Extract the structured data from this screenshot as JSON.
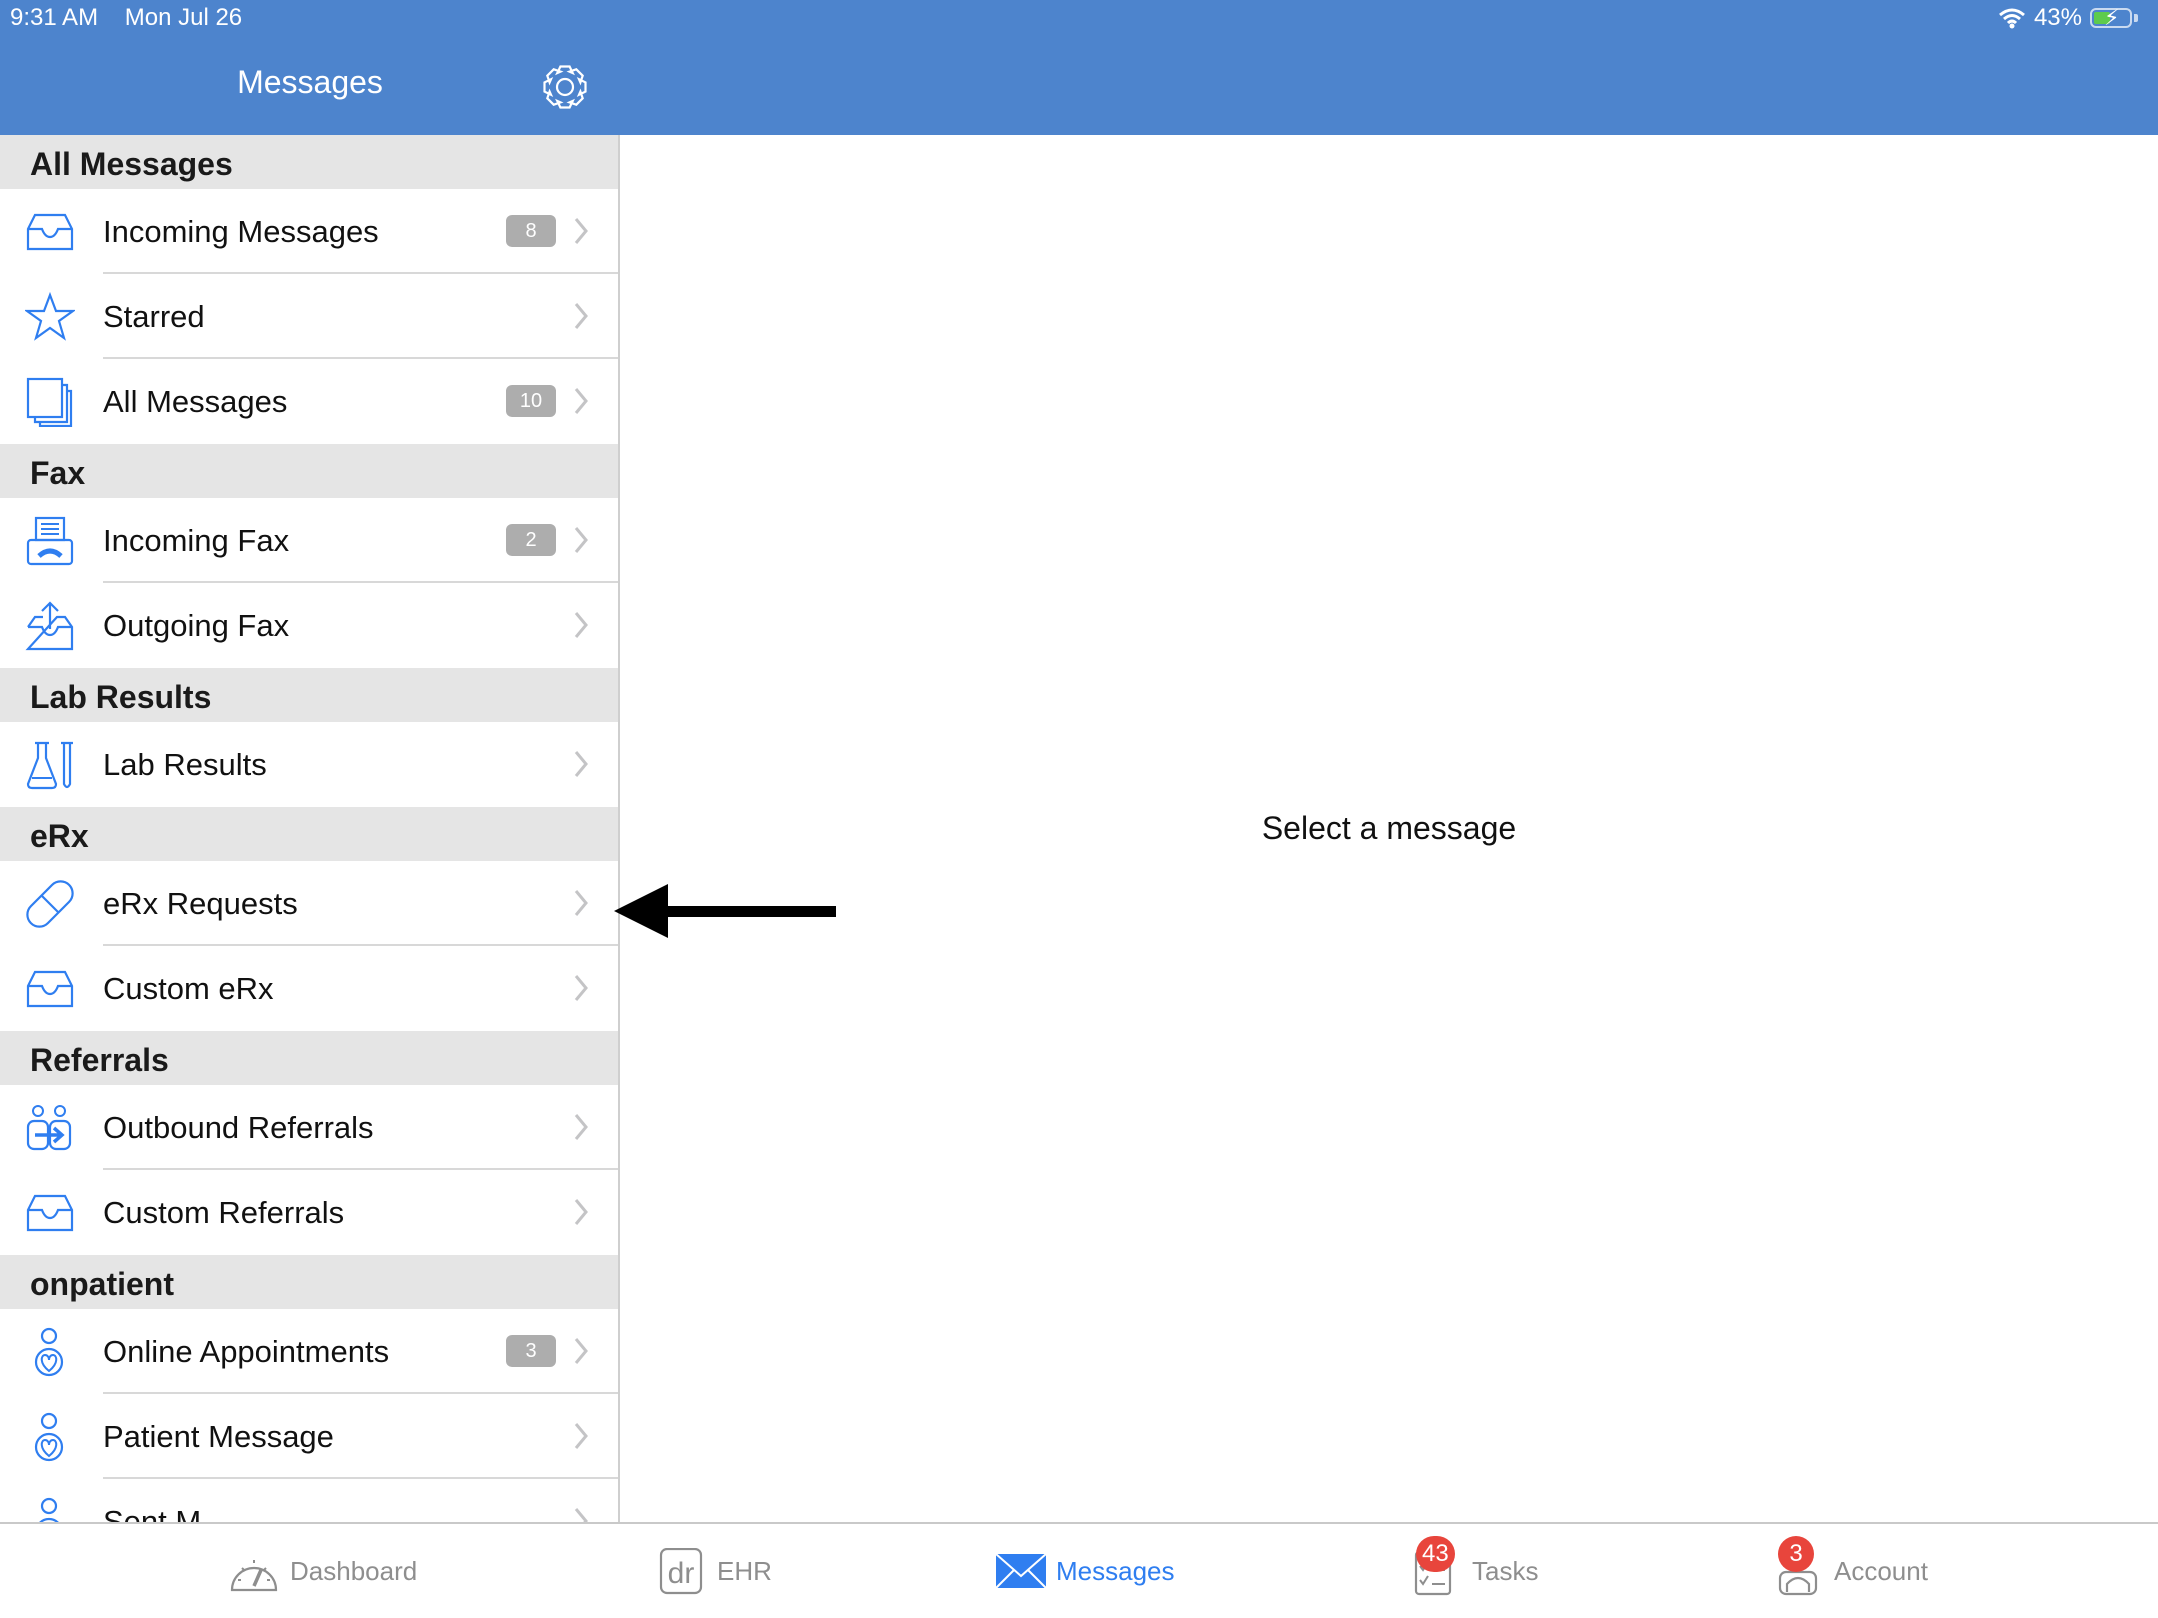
{
  "status_bar": {
    "time": "9:31 AM",
    "date": "Mon Jul 26",
    "battery": "43%",
    "battery_level": 0.43
  },
  "header": {
    "title": "Messages"
  },
  "sections": [
    {
      "title": "All Messages",
      "items": [
        {
          "label": "Incoming Messages",
          "icon": "inbox-tray-icon",
          "badge": "8"
        },
        {
          "label": "Starred",
          "icon": "star-icon",
          "badge": null
        },
        {
          "label": "All Messages",
          "icon": "stacked-documents-icon",
          "badge": "10"
        }
      ]
    },
    {
      "title": "Fax",
      "items": [
        {
          "label": "Incoming Fax",
          "icon": "fax-machine-icon",
          "badge": "2"
        },
        {
          "label": "Outgoing Fax",
          "icon": "outbox-upload-icon",
          "badge": null
        }
      ]
    },
    {
      "title": "Lab Results",
      "items": [
        {
          "label": "Lab Results",
          "icon": "flask-test-tube-icon",
          "badge": null
        }
      ]
    },
    {
      "title": "eRx",
      "items": [
        {
          "label": "eRx Requests",
          "icon": "pill-icon",
          "badge": null
        },
        {
          "label": "Custom eRx",
          "icon": "inbox-tray-icon",
          "badge": null
        }
      ]
    },
    {
      "title": "Referrals",
      "items": [
        {
          "label": "Outbound Referrals",
          "icon": "people-arrow-icon",
          "badge": null
        },
        {
          "label": "Custom Referrals",
          "icon": "inbox-tray-icon",
          "badge": null
        }
      ]
    },
    {
      "title": "onpatient",
      "items": [
        {
          "label": "Online Appointments",
          "icon": "onpatient-person-heart-icon",
          "badge": "3"
        },
        {
          "label": "Patient Message",
          "icon": "onpatient-person-heart-icon",
          "badge": null
        },
        {
          "label": "Sent M",
          "icon": "onpatient-person-heart-icon",
          "badge": null
        }
      ]
    }
  ],
  "detail": {
    "placeholder": "Select a message"
  },
  "tabs": [
    {
      "label": "Dashboard",
      "icon": "speedometer-icon",
      "badge": null,
      "active": false
    },
    {
      "label": "EHR",
      "icon": "dr-logo-icon",
      "badge": null,
      "active": false
    },
    {
      "label": "Messages",
      "icon": "envelope-icon",
      "badge": null,
      "active": true
    },
    {
      "label": "Tasks",
      "icon": "checklist-icon",
      "badge": "43",
      "active": false
    },
    {
      "label": "Account",
      "icon": "person-headset-icon",
      "badge": "3",
      "active": false
    }
  ],
  "colors": {
    "brand_blue": "#4d84cd",
    "icon_blue": "#2f7ef0",
    "badge_gray": "#adadad",
    "badge_red": "#e8453c",
    "section_bg": "#e5e5e5"
  }
}
